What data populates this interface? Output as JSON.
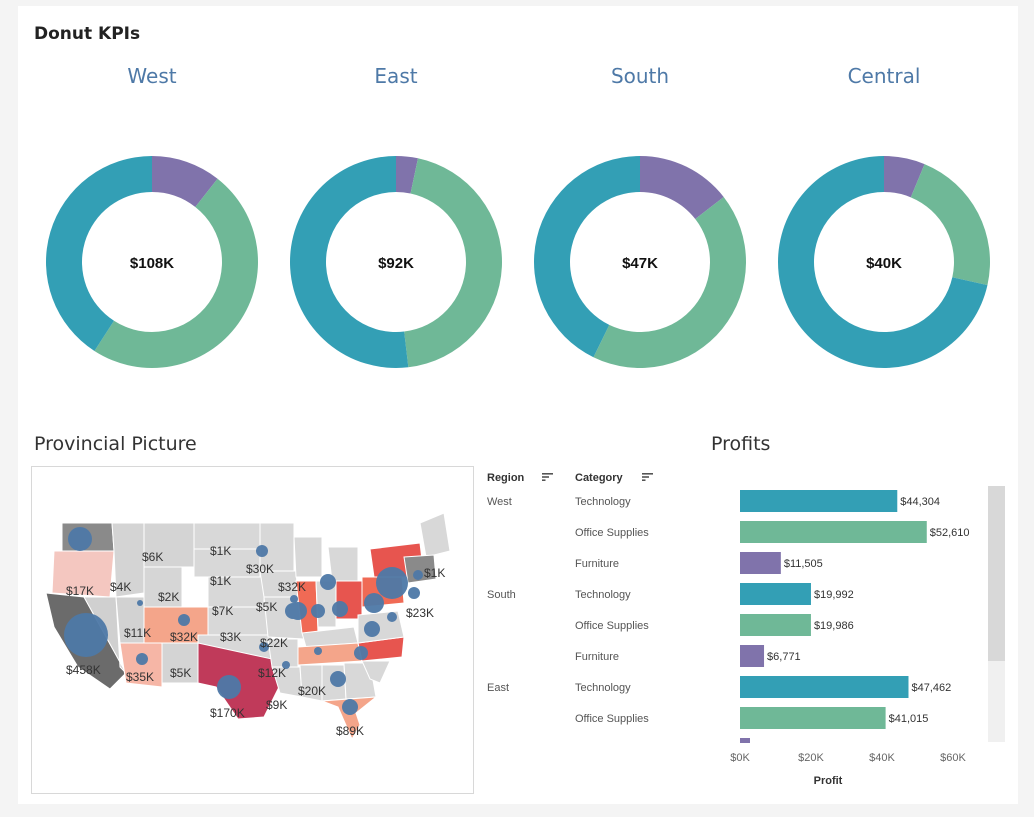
{
  "dashboard": {
    "title": "Donut KPIs",
    "map_title": "Provincial Picture",
    "bars_title": "Profits"
  },
  "colors": {
    "technology": "#339fb5",
    "office_supplies": "#6fb897",
    "furniture": "#8073ab",
    "region_title": "#4e79a7",
    "map_bubble": "#4e79a7"
  },
  "donuts": [
    {
      "region": "West",
      "label": "$108K",
      "segments": [
        {
          "category": "Furniture",
          "value": 11505
        },
        {
          "category": "Office Supplies",
          "value": 52610
        },
        {
          "category": "Technology",
          "value": 44304
        }
      ]
    },
    {
      "region": "East",
      "label": "$92K",
      "segments": [
        {
          "category": "Furniture",
          "value": 3046
        },
        {
          "category": "Office Supplies",
          "value": 41015
        },
        {
          "category": "Technology",
          "value": 47462
        }
      ]
    },
    {
      "region": "South",
      "label": "$47K",
      "segments": [
        {
          "category": "Furniture",
          "value": 6771
        },
        {
          "category": "Office Supplies",
          "value": 19986
        },
        {
          "category": "Technology",
          "value": 19992
        }
      ]
    },
    {
      "region": "Central",
      "label": "$40K",
      "segments": [
        {
          "category": "Furniture",
          "value": 2500
        },
        {
          "category": "Office Supplies",
          "value": 8900
        },
        {
          "category": "Technology",
          "value": 28600
        }
      ]
    }
  ],
  "map_labels": [
    "$6K",
    "$1K",
    "$4K",
    "$2K",
    "$1K",
    "$30K",
    "$1K",
    "$17K",
    "$7K",
    "$32K",
    "$5K",
    "$11K",
    "$32K",
    "$3K",
    "$23K",
    "$22K",
    "$458K",
    "$12K",
    "$35K",
    "$5K",
    "$20K",
    "$9K",
    "$170K",
    "$89K"
  ],
  "table": {
    "region_header": "Region",
    "category_header": "Category",
    "rows": [
      {
        "region": "West",
        "category": "Technology",
        "value_label": "$44,304"
      },
      {
        "region": "",
        "category": "Office Supplies",
        "value_label": "$52,610"
      },
      {
        "region": "",
        "category": "Furniture",
        "value_label": "$11,505"
      },
      {
        "region": "South",
        "category": "Technology",
        "value_label": "$19,992"
      },
      {
        "region": "",
        "category": "Office Supplies",
        "value_label": "$19,986"
      },
      {
        "region": "",
        "category": "Furniture",
        "value_label": "$6,771"
      },
      {
        "region": "East",
        "category": "Technology",
        "value_label": "$47,462"
      },
      {
        "region": "",
        "category": "Office Supplies",
        "value_label": "$41,015"
      }
    ]
  },
  "chart_data": {
    "type": "bar",
    "orientation": "horizontal",
    "xlabel": "Profit",
    "xlim": [
      0,
      60000
    ],
    "ticks": [
      "$0K",
      "$20K",
      "$40K",
      "$60K"
    ],
    "tick_values": [
      0,
      20000,
      40000,
      60000
    ],
    "categories": [
      "West / Technology",
      "West / Office Supplies",
      "West / Furniture",
      "South / Technology",
      "South / Office Supplies",
      "South / Furniture",
      "East / Technology",
      "East / Office Supplies"
    ],
    "values": [
      44304,
      52610,
      11505,
      19992,
      19986,
      6771,
      47462,
      41015
    ],
    "category_colors": [
      "technology",
      "office_supplies",
      "furniture",
      "technology",
      "office_supplies",
      "furniture",
      "technology",
      "office_supplies"
    ]
  }
}
